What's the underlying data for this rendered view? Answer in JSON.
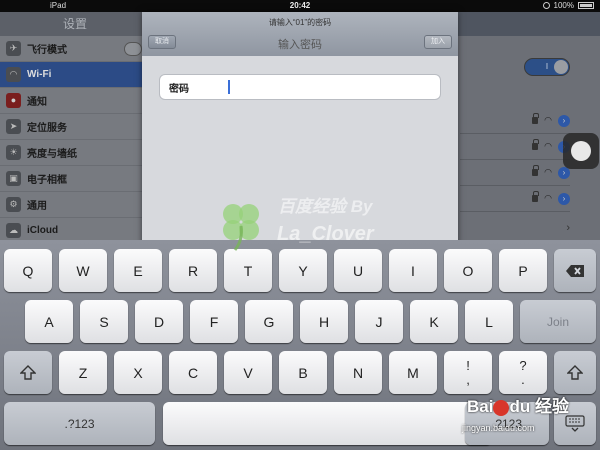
{
  "status_bar": {
    "device": "iPad",
    "time": "20:42",
    "battery": "100%"
  },
  "sidebar": {
    "title": "设置",
    "items": [
      {
        "label": "飞行模式",
        "icon": "airplane-icon"
      },
      {
        "label": "Wi-Fi",
        "icon": "wifi-icon"
      },
      {
        "label": "通知",
        "icon": "notifications-icon"
      },
      {
        "label": "定位服务",
        "icon": "location-icon"
      },
      {
        "label": "亮度与墙纸",
        "icon": "brightness-icon"
      },
      {
        "label": "电子相框",
        "icon": "picture-frame-icon"
      },
      {
        "label": "通用",
        "icon": "gear-icon"
      },
      {
        "label": "iCloud",
        "icon": "cloud-icon"
      }
    ]
  },
  "wifi_toggle": {
    "label": "I"
  },
  "modal": {
    "prompt": "请输入“01”的密码",
    "title": "输入密码",
    "cancel_label": "取消",
    "join_label": "加入",
    "password_label": "密码"
  },
  "keyboard": {
    "row1": [
      "Q",
      "W",
      "E",
      "R",
      "T",
      "Y",
      "U",
      "I",
      "O",
      "P"
    ],
    "row2": [
      "A",
      "S",
      "D",
      "F",
      "G",
      "H",
      "J",
      "K",
      "L"
    ],
    "row3": [
      "Z",
      "X",
      "C",
      "V",
      "B",
      "N",
      "M"
    ],
    "join": "Join",
    "excl_top": "!",
    "excl_bottom": ",",
    "quest_top": "?",
    "quest_bottom": ".",
    "numbers_left": ".?123",
    "numbers_right": ".?123"
  },
  "watermark": {
    "line1": "百度经验",
    "by": "By",
    "line2": "La_Clover",
    "baidu_text": "Bai",
    "baidu_text2": "du",
    "baidu_jingyan": "经验",
    "url": "jingyan.baidu.com"
  },
  "colors": {
    "keyboard_bg": "#7d818a",
    "selected_row": "#2c4b86",
    "caret": "#3a6fd8"
  }
}
